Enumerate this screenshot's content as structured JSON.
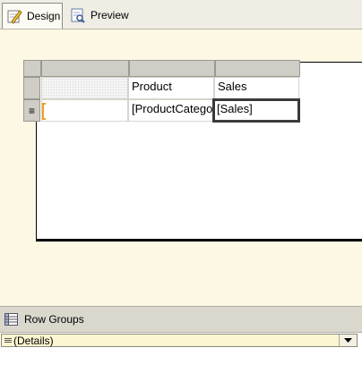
{
  "tabs": [
    {
      "label": "Design",
      "icon": "design-pencil-icon",
      "active": true
    },
    {
      "label": "Preview",
      "icon": "preview-icon",
      "active": false
    }
  ],
  "tablix": {
    "header_row": [
      "",
      "Product",
      "Sales"
    ],
    "detail_row": [
      "",
      "[ProductCatego",
      "[Sales]"
    ],
    "row_handle_symbol": "≡"
  },
  "row_groups": {
    "title": "Row Groups",
    "items": [
      {
        "label": "(Details)"
      }
    ]
  },
  "colors": {
    "surface": "#fdf8e4",
    "bracket": "#f0a020",
    "group_item_bg": "#fcf6d2"
  }
}
